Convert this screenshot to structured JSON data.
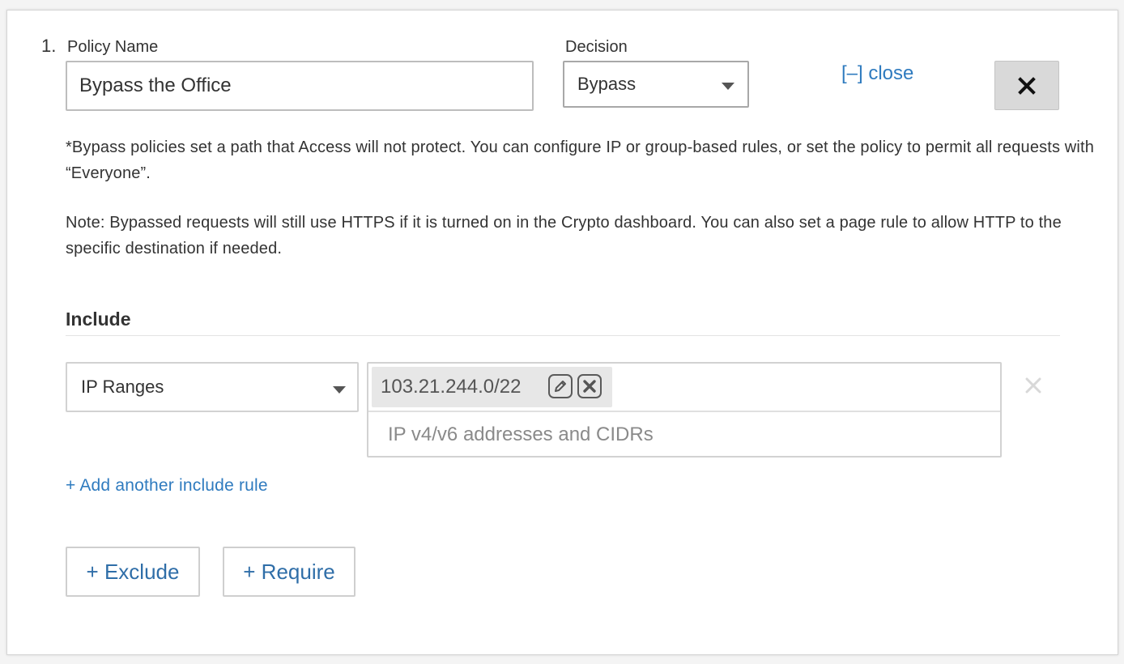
{
  "policy": {
    "number": "1.",
    "name_label": "Policy Name",
    "name_value": "Bypass the Office",
    "decision_label": "Decision",
    "decision_value": "Bypass",
    "close_link": "[–] close"
  },
  "notes": {
    "bypass_note": "*Bypass policies set a path that Access will not protect. You can configure IP or group-based rules, or set the policy to permit all requests with “Everyone”.",
    "https_note": "Note: Bypassed requests will still use HTTPS if it is turned on in the Crypto dashboard. You can also set a page rule to allow HTTP to the specific destination if needed."
  },
  "include": {
    "heading": "Include",
    "rules": [
      {
        "type": "IP Ranges",
        "values": [
          "103.21.244.0/22"
        ],
        "placeholder": "IP v4/v6 addresses and CIDRs"
      }
    ],
    "add_rule_link": "+ Add another include rule"
  },
  "actions": {
    "exclude_label": "+ Exclude",
    "require_label": "+ Require"
  },
  "icons": {
    "close_x": "close-icon",
    "chip_edit": "pencil-icon",
    "chip_remove": "remove-icon",
    "row_remove": "close-icon",
    "select_caret": "caret-down-icon"
  },
  "colors": {
    "link": "#2f7bbf",
    "button_text": "#2f6ea8",
    "chip_bg": "#e7e7e7",
    "close_button_bg": "#d9d9d9"
  }
}
